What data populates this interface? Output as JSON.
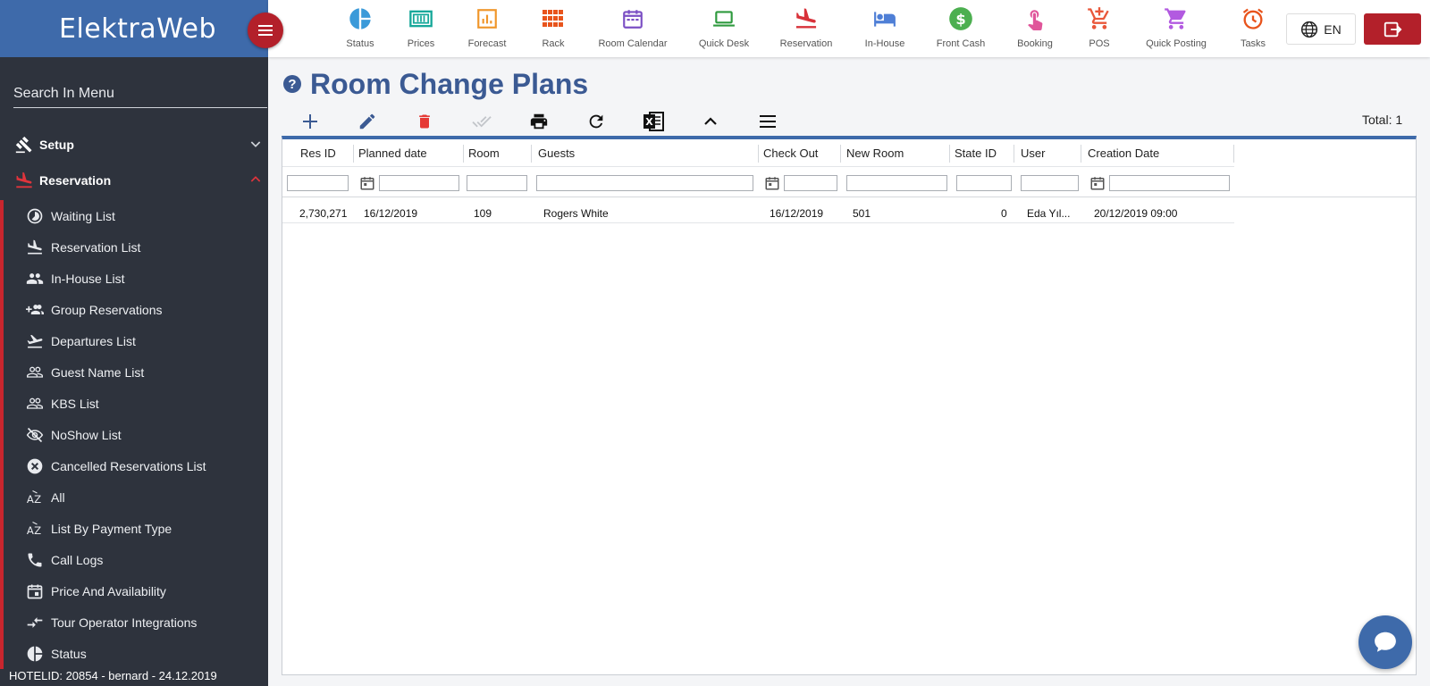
{
  "app": {
    "logo": "ElektraWeb"
  },
  "sidebar": {
    "search_placeholder": "Search In Menu",
    "groups": [
      {
        "label": "Setup",
        "icon": "gavel-icon",
        "expanded": false
      },
      {
        "label": "Reservation",
        "icon": "flight-land-icon",
        "expanded": true
      }
    ],
    "items": [
      {
        "label": "Waiting List",
        "icon": "timelapse-icon"
      },
      {
        "label": "Reservation List",
        "icon": "flight-land-icon"
      },
      {
        "label": "In-House List",
        "icon": "people-icon"
      },
      {
        "label": "Group Reservations",
        "icon": "group-add-icon"
      },
      {
        "label": "Departures List",
        "icon": "flight-takeoff-icon"
      },
      {
        "label": "Guest Name List",
        "icon": "people-outline-icon"
      },
      {
        "label": "KBS List",
        "icon": "people-outline-icon"
      },
      {
        "label": "NoShow List",
        "icon": "visibility-off-icon"
      },
      {
        "label": "Cancelled Reservations List",
        "icon": "cancel-icon"
      },
      {
        "label": "All",
        "icon": "sort-az-icon"
      },
      {
        "label": "List By Payment Type",
        "icon": "sort-az-icon"
      },
      {
        "label": "Call Logs",
        "icon": "phone-icon"
      },
      {
        "label": "Price And Availability",
        "icon": "event-icon"
      },
      {
        "label": "Tour Operator Integrations",
        "icon": "compare-arrows-icon"
      },
      {
        "label": "Status",
        "icon": "pie-chart-icon"
      }
    ],
    "footer": "HOTELID: 20854 - bernard - 24.12.2019"
  },
  "topbar": {
    "items": [
      {
        "label": "Status",
        "icon": "pie-chart-icon",
        "color": "#3b9ad9"
      },
      {
        "label": "Prices",
        "icon": "money-icon",
        "color": "#17a89a"
      },
      {
        "label": "Forecast",
        "icon": "chart-icon",
        "color": "#f0962a"
      },
      {
        "label": "Rack",
        "icon": "grid-icon",
        "color": "#e8541c"
      },
      {
        "label": "Room Calendar",
        "icon": "calendar-icon",
        "color": "#7b4fc4"
      },
      {
        "label": "Quick Desk",
        "icon": "laptop-icon",
        "color": "#2e9a3e"
      },
      {
        "label": "Reservation",
        "icon": "flight-land-icon",
        "color": "#d8323a"
      },
      {
        "label": "In-House",
        "icon": "hotel-bed-icon",
        "color": "#4f7fd6"
      },
      {
        "label": "Front Cash",
        "icon": "dollar-icon",
        "color": "#4caf50"
      },
      {
        "label": "Booking",
        "icon": "touch-icon",
        "color": "#e0559a"
      },
      {
        "label": "POS",
        "icon": "cart-plus-icon",
        "color": "#e9573a"
      },
      {
        "label": "Quick Posting",
        "icon": "cart-icon",
        "color": "#b25ae0"
      },
      {
        "label": "Tasks",
        "icon": "alarm-icon",
        "color": "#e8541c"
      }
    ],
    "language": "EN"
  },
  "page": {
    "title": "Room Change Plans",
    "total": "Total: 1"
  },
  "actions": [
    "add-icon",
    "edit-icon",
    "delete-icon",
    "approve-icon",
    "print-icon",
    "refresh-icon",
    "excel-icon",
    "collapse-icon",
    "menu-icon"
  ],
  "grid": {
    "columns": [
      "Res ID",
      "Planned date",
      "Room",
      "Guests",
      "Check Out",
      "New Room",
      "State ID",
      "User",
      "Creation Date"
    ],
    "rows": [
      {
        "res_id": "2,730,271",
        "planned_date": "16/12/2019",
        "room": "109",
        "guests": "Rogers White",
        "check_out": "16/12/2019",
        "new_room": "501",
        "state_id": "0",
        "user": "Eda Yıl...",
        "creation_date": "20/12/2019 09:00"
      }
    ]
  },
  "colors": {
    "brand_blue": "#3e6aaa",
    "title_blue": "#3b5a93",
    "accent_red": "#b3202a",
    "sidebar_bg": "#2e333d"
  }
}
